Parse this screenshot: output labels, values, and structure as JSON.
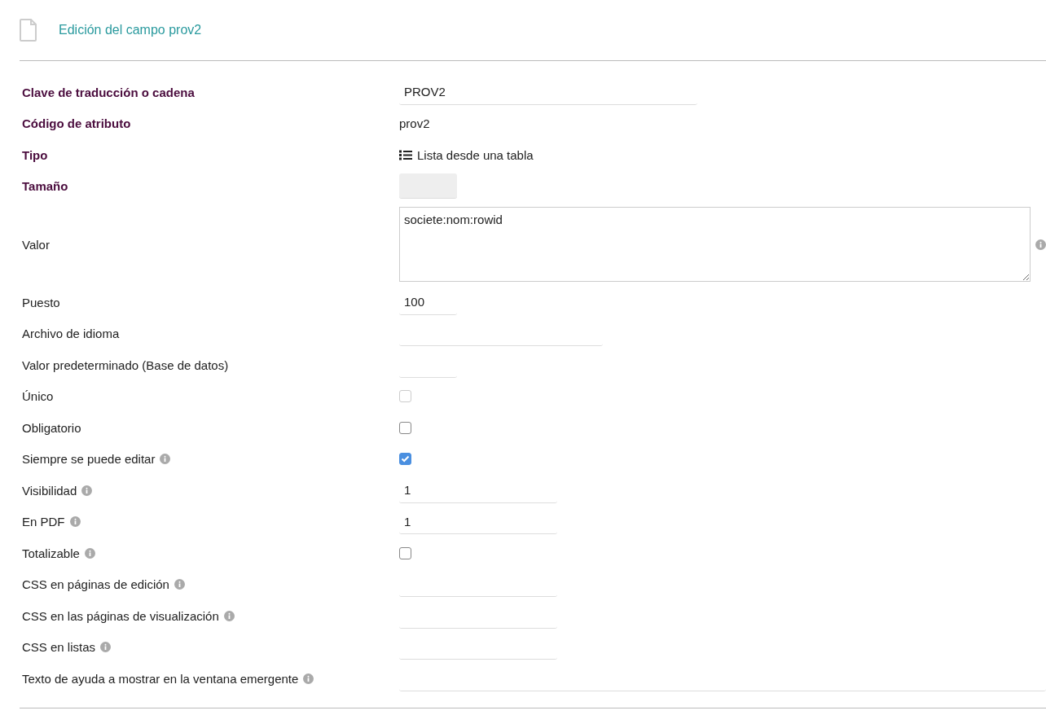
{
  "header": {
    "title": "Edición del campo prov2"
  },
  "rows": [
    {
      "label": "Clave de traducción o cadena",
      "required": true,
      "info": false,
      "kind": "wide-input",
      "value": "PROV2"
    },
    {
      "label": "Código de atributo",
      "required": true,
      "info": false,
      "kind": "plain",
      "value": "prov2"
    },
    {
      "label": "Tipo",
      "required": true,
      "info": false,
      "kind": "type",
      "value": "Lista desde una tabla"
    },
    {
      "label": "Tamaño",
      "required": true,
      "info": false,
      "kind": "disabled-input"
    },
    {
      "label": "Valor",
      "required": false,
      "info": false,
      "kind": "textarea",
      "value": "societe:nom:rowid"
    },
    {
      "label": "Puesto",
      "required": false,
      "info": false,
      "kind": "short-input",
      "value": "100"
    },
    {
      "label": "Archivo de idioma",
      "required": false,
      "info": false,
      "kind": "long-input"
    },
    {
      "label": "Valor predeterminado (Base de datos)",
      "required": false,
      "info": false,
      "kind": "short-input"
    },
    {
      "label": "Único",
      "required": false,
      "info": false,
      "kind": "checkbox",
      "checked": false,
      "disabled": true
    },
    {
      "label": "Obligatorio",
      "required": false,
      "info": false,
      "kind": "checkbox",
      "checked": false,
      "disabled": false
    },
    {
      "label": "Siempre se puede editar",
      "required": false,
      "info": true,
      "kind": "checkbox",
      "checked": true,
      "disabled": false
    },
    {
      "label": "Visibilidad",
      "required": false,
      "info": true,
      "kind": "medium-input",
      "value": "1"
    },
    {
      "label": "En PDF",
      "required": false,
      "info": true,
      "kind": "medium-input",
      "value": "1"
    },
    {
      "label": "Totalizable",
      "required": false,
      "info": true,
      "kind": "checkbox",
      "checked": false,
      "disabled": false
    },
    {
      "label": "CSS en páginas de edición",
      "required": false,
      "info": true,
      "kind": "medium-input"
    },
    {
      "label": "CSS en las páginas de visualización",
      "required": false,
      "info": true,
      "kind": "medium-input"
    },
    {
      "label": "CSS en listas",
      "required": false,
      "info": true,
      "kind": "medium-input"
    },
    {
      "label": "Texto de ayuda a mostrar en la ventana emergente",
      "required": false,
      "info": true,
      "kind": "full-input"
    }
  ]
}
